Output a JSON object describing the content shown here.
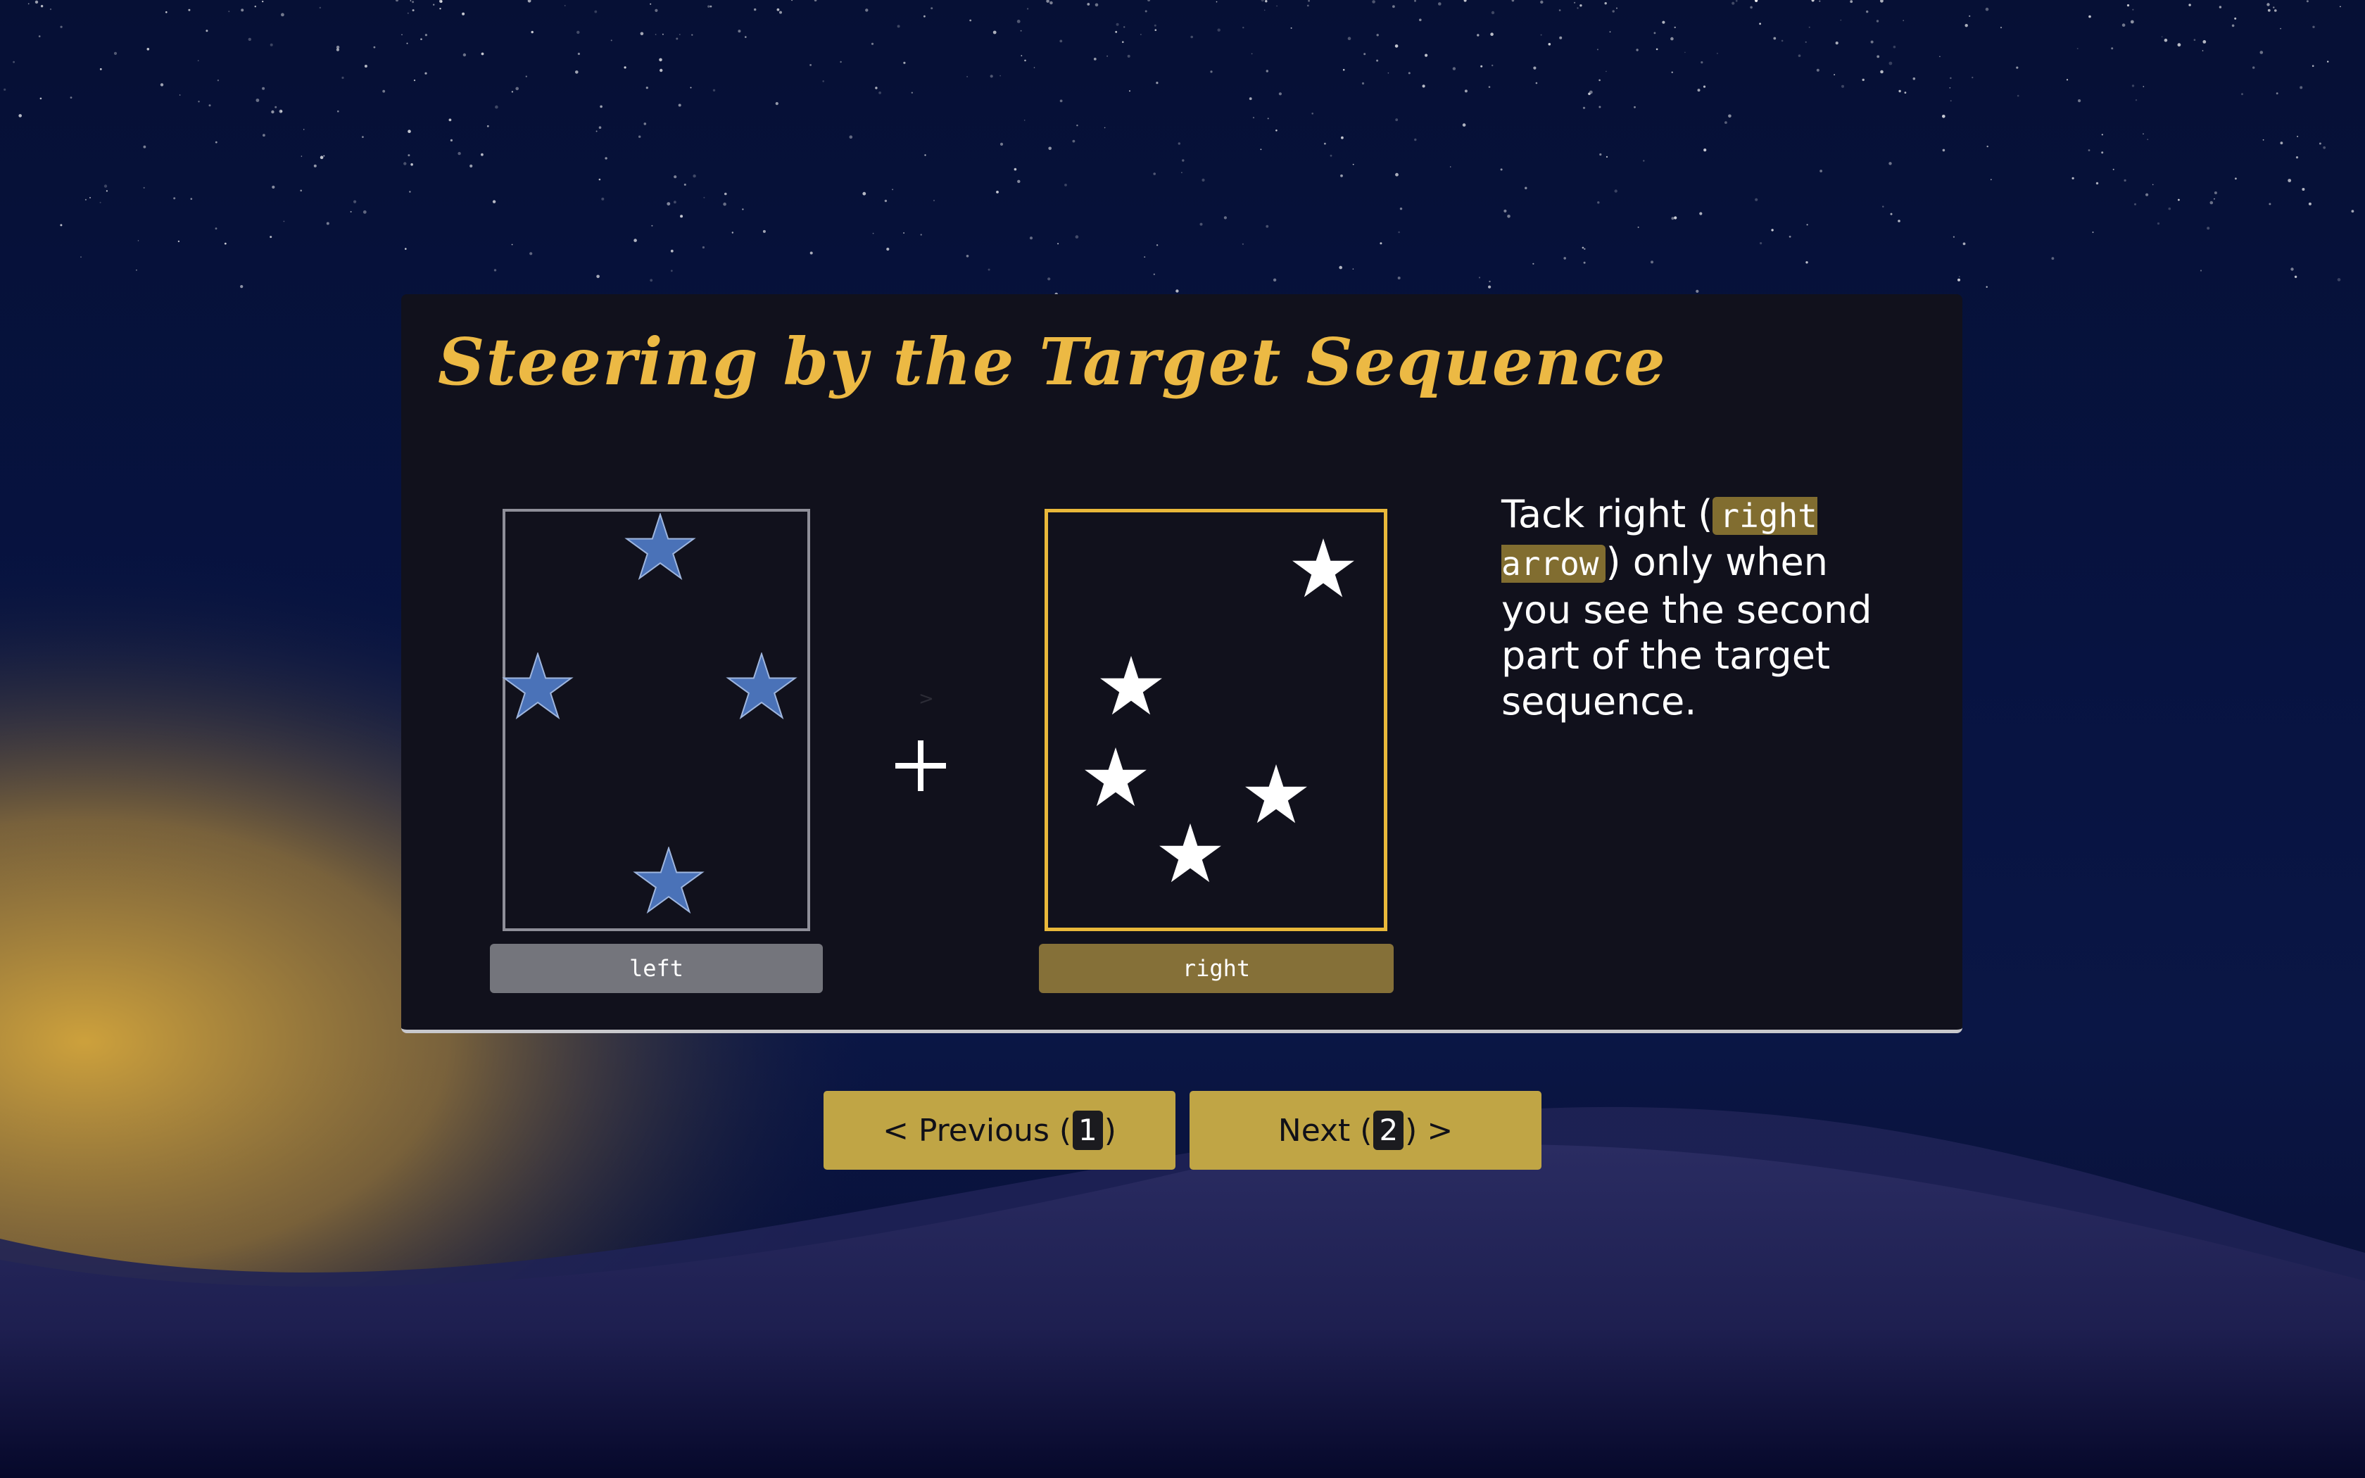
{
  "panel": {
    "title": "Steering by the Target Sequence"
  },
  "stimuli": {
    "left_label": "left",
    "right_label": "right",
    "left_star_color": "#4a72b8",
    "right_star_color": "#ffffff",
    "fixation": "+",
    "hint_arrow": ">"
  },
  "instructions": {
    "before": "Tack right (",
    "key": "right arrow",
    "after": ") only when you see the second part of the target sequence."
  },
  "navigation": {
    "previous_prefix": "< Previous (",
    "previous_key": "1",
    "previous_suffix": ")",
    "next_prefix": "Next (",
    "next_key": "2",
    "next_suffix": ") >"
  },
  "colors": {
    "accent": "#ecb944",
    "button": "#c0a545",
    "panel_background": "#11111c",
    "sky": "#061035",
    "hill": "#25275a",
    "glow": "#c9a040"
  }
}
